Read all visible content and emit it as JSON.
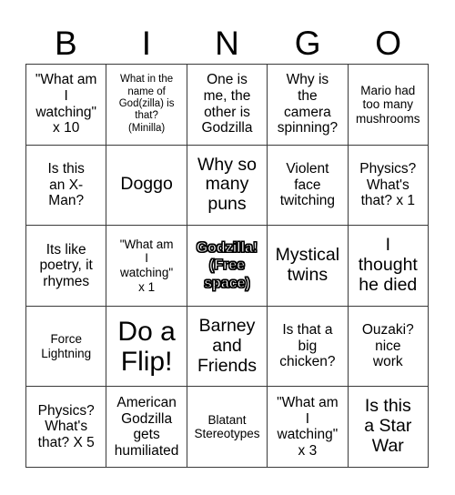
{
  "card": {
    "header_letters": [
      "B",
      "I",
      "N",
      "G",
      "O"
    ],
    "cells": [
      {
        "text": "\"What am\nI\nwatching\"\nx 10",
        "size": "sz-md",
        "free_space": false
      },
      {
        "text": "What in the\nname of\nGod(zilla) is\nthat?\n(Minilla)",
        "size": "sz-xs",
        "free_space": false
      },
      {
        "text": "One is\nme, the\nother is\nGodzilla",
        "size": "sz-md",
        "free_space": false
      },
      {
        "text": "Why is\nthe\ncamera\nspinning?",
        "size": "sz-md",
        "free_space": false
      },
      {
        "text": "Mario had\ntoo many\nmushrooms",
        "size": "sz-sm",
        "free_space": false
      },
      {
        "text": "Is this\nan X-\nMan?",
        "size": "sz-md",
        "free_space": false
      },
      {
        "text": "Doggo",
        "size": "sz-lg",
        "free_space": false
      },
      {
        "text": "Why so\nmany\npuns",
        "size": "sz-lg",
        "free_space": false
      },
      {
        "text": "Violent\nface\ntwitching",
        "size": "sz-md",
        "free_space": false
      },
      {
        "text": "Physics?\nWhat's\nthat? x 1",
        "size": "sz-md",
        "free_space": false
      },
      {
        "text": "Its like\npoetry, it\nrhymes",
        "size": "sz-md",
        "free_space": false
      },
      {
        "text": "\"What am\nI\nwatching\"\nx 1",
        "size": "sz-sm",
        "free_space": false
      },
      {
        "text": "Godzilla!\n(Free\nspace)",
        "size": "sz-md",
        "free_space": true
      },
      {
        "text": "Mystical\ntwins",
        "size": "sz-lg",
        "free_space": false
      },
      {
        "text": "I\nthought\nhe died",
        "size": "sz-lg",
        "free_space": false
      },
      {
        "text": "Force\nLightning",
        "size": "sz-sm",
        "free_space": false
      },
      {
        "text": "Do a\nFlip!",
        "size": "sz-xl",
        "free_space": false
      },
      {
        "text": "Barney\nand\nFriends",
        "size": "sz-lg",
        "free_space": false
      },
      {
        "text": "Is that a\nbig\nchicken?",
        "size": "sz-md",
        "free_space": false
      },
      {
        "text": "Ouzaki?\nnice\nwork",
        "size": "sz-md",
        "free_space": false
      },
      {
        "text": "Physics?\nWhat's\nthat? X 5",
        "size": "sz-md",
        "free_space": false
      },
      {
        "text": "American\nGodzilla\ngets\nhumiliated",
        "size": "sz-md",
        "free_space": false
      },
      {
        "text": "Blatant\nStereotypes",
        "size": "sz-sm",
        "free_space": false
      },
      {
        "text": "\"What am\nI\nwatching\"\nx 3",
        "size": "sz-md",
        "free_space": false
      },
      {
        "text": "Is this\na Star\nWar",
        "size": "sz-lg",
        "free_space": false
      }
    ]
  },
  "colors": {
    "background": "#ffffff",
    "text": "#000000",
    "grid_line": "#3a3a3a",
    "free_space_fill": "#ffffff",
    "free_space_outline": "#000000"
  }
}
